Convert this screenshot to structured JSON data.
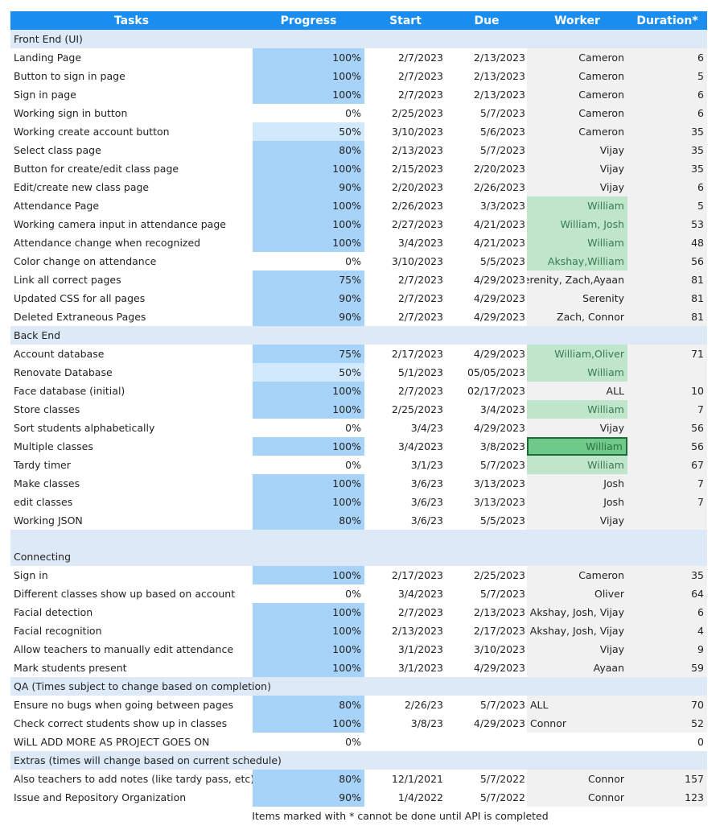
{
  "headers": {
    "task": "Tasks",
    "progress": "Progress",
    "start": "Start",
    "due": "Due",
    "worker": "Worker",
    "duration": "Duration*"
  },
  "colors": {
    "header": "#1a8ef0",
    "section": "#dde9f6",
    "progress_full": "#a8d3f8",
    "progress_mid": "#d2e8fc",
    "worker_bg": "#f1f1f1",
    "worker_green": "#bfe6cb",
    "worker_selected": "#6fca8a"
  },
  "sections": [
    {
      "title": "Front End (UI)",
      "rows": [
        {
          "task": "Landing Page",
          "progress": "100%",
          "start": "2/7/2023",
          "due": "2/13/2023",
          "worker": "Cameron",
          "duration": "6"
        },
        {
          "task": "Button to sign in page",
          "progress": "100%",
          "start": "2/7/2023",
          "due": "2/13/2023",
          "worker": "Cameron",
          "duration": "5"
        },
        {
          "task": "Sign in page",
          "progress": "100%",
          "start": "2/7/2023",
          "due": "2/13/2023",
          "worker": "Cameron",
          "duration": "6"
        },
        {
          "task": "Working sign in button",
          "progress": "0%",
          "start": "2/25/2023",
          "due": "5/7/2023",
          "worker": "Cameron",
          "duration": "6"
        },
        {
          "task": "Working create account button",
          "progress": "50%",
          "start": "3/10/2023",
          "due": "5/6/2023",
          "worker": "Cameron",
          "duration": "35"
        },
        {
          "task": "Select class page",
          "progress": "80%",
          "start": "2/13/2023",
          "due": "5/7/2023",
          "worker": "Vijay",
          "duration": "35"
        },
        {
          "task": "Button for create/edit class page",
          "progress": "100%",
          "start": "2/15/2023",
          "due": "2/20/2023",
          "worker": "Vijay",
          "duration": "35"
        },
        {
          "task": "Edit/create new class page",
          "progress": "90%",
          "start": "2/20/2023",
          "due": "2/26/2023",
          "worker": "Vijay",
          "duration": "6"
        },
        {
          "task": "Attendance Page",
          "progress": "100%",
          "start": "2/26/2023",
          "due": "3/3/2023",
          "worker": "William",
          "duration": "5",
          "style": "green"
        },
        {
          "task": "Working camera input in attendance page",
          "progress": "100%",
          "start": "2/27/2023",
          "due": "4/21/2023",
          "worker": "William, Josh",
          "duration": "53",
          "style": "green"
        },
        {
          "task": "Attendance change when recognized",
          "progress": "100%",
          "start": "3/4/2023",
          "due": "4/21/2023",
          "worker": "William",
          "duration": "48",
          "style": "green"
        },
        {
          "task": "Color change on attendance",
          "progress": "0%",
          "start": "3/10/2023",
          "due": "5/5/2023",
          "worker": "Akshay,William",
          "duration": "56",
          "style": "green"
        },
        {
          "task": "Link all correct pages",
          "progress": "75%",
          "start": "2/7/2023",
          "due": "4/29/2023",
          "worker": "Serenity, Zach,Ayaan",
          "duration": "81"
        },
        {
          "task": "Updated CSS for all pages",
          "progress": "90%",
          "start": "2/7/2023",
          "due": "4/29/2023",
          "worker": "Serenity",
          "duration": "81"
        },
        {
          "task": "Deleted Extraneous Pages",
          "progress": "90%",
          "start": "2/7/2023",
          "due": "4/29/2023",
          "worker": "Zach, Connor",
          "duration": "81"
        }
      ]
    },
    {
      "title": "Back End",
      "rows": [
        {
          "task": "Account database",
          "progress": "75%",
          "start": "2/17/2023",
          "due": "4/29/2023",
          "worker": "William,Oliver",
          "duration": "71",
          "style": "green"
        },
        {
          "task": "Renovate Database",
          "progress": "50%",
          "start": "5/1/2023",
          "due": "05/05/2023",
          "worker": "William",
          "duration": "",
          "style": "green"
        },
        {
          "task": "Face database (initial)",
          "progress": "100%",
          "start": "2/7/2023",
          "due": "02/17/2023",
          "worker": "ALL",
          "duration": "10"
        },
        {
          "task": "Store classes",
          "progress": "100%",
          "start": "2/25/2023",
          "due": "3/4/2023",
          "worker": "William",
          "duration": "7",
          "style": "green"
        },
        {
          "task": "Sort students alphabetically",
          "progress": "0%",
          "start": "3/4/23",
          "due": "4/29/2023",
          "worker": "Vijay",
          "duration": "56"
        },
        {
          "task": "Multiple classes",
          "progress": "100%",
          "start": "3/4/2023",
          "due": "3/8/2023",
          "worker": "William",
          "duration": "56",
          "style": "selected"
        },
        {
          "task": "Tardy timer",
          "progress": "0%",
          "start": "3/1/23",
          "due": "5/7/2023",
          "worker": "William",
          "duration": "67",
          "style": "green"
        },
        {
          "task": "Make classes",
          "progress": "100%",
          "start": "3/6/23",
          "due": "3/13/2023",
          "worker": "Josh",
          "duration": "7"
        },
        {
          "task": "edit classes",
          "progress": "100%",
          "start": "3/6/23",
          "due": "3/13/2023",
          "worker": "Josh",
          "duration": "7"
        },
        {
          "task": "Working JSON",
          "progress": "80%",
          "start": "3/6/23",
          "due": "5/5/2023",
          "worker": "Vijay",
          "duration": ""
        }
      ]
    },
    {
      "title": "Connecting",
      "tall": true,
      "rows": [
        {
          "task": "Sign in",
          "progress": "100%",
          "start": "2/17/2023",
          "due": "2/25/2023",
          "worker": "Cameron",
          "duration": "35"
        },
        {
          "task": "Different classes show up based on account",
          "progress": "0%",
          "start": "3/4/2023",
          "due": "5/7/2023",
          "worker": "Oliver",
          "duration": "64"
        },
        {
          "task": "Facial detection",
          "progress": "100%",
          "start": "2/7/2023",
          "due": "2/13/2023",
          "worker": "Akshay, Josh, Vijay",
          "duration": "6"
        },
        {
          "task": "Facial recognition",
          "progress": "100%",
          "start": "2/13/2023",
          "due": "2/17/2023",
          "worker": "Akshay, Josh, Vijay",
          "duration": "4"
        },
        {
          "task": "Allow teachers to manually edit attendance",
          "progress": "100%",
          "start": "3/1/2023",
          "due": "3/10/2023",
          "worker": "Vijay",
          "duration": "9"
        },
        {
          "task": "Mark students present",
          "progress": "100%",
          "start": "3/1/2023",
          "due": "4/29/2023",
          "worker": "Ayaan",
          "duration": "59"
        }
      ]
    },
    {
      "title": "QA (Times subject to change based on completion)",
      "rows": [
        {
          "task": "Ensure no bugs when going between pages",
          "progress": "80%",
          "start": "2/26/23",
          "due": "5/7/2023",
          "worker": "ALL",
          "duration": "70",
          "style": "left"
        },
        {
          "task": "Check correct students show up in classes",
          "progress": "100%",
          "start": "3/8/23",
          "due": "4/29/2023",
          "worker": "Connor",
          "duration": "52",
          "style": "left"
        },
        {
          "task": "WiLL ADD MORE AS PROJECT GOES ON",
          "progress": "0%",
          "start": "",
          "due": "",
          "worker": "",
          "duration": "0",
          "style": "blank"
        }
      ]
    },
    {
      "title": "Extras (times will change based on current schedule)",
      "rows": [
        {
          "task": "Also teachers to add notes (like tardy pass, etc)",
          "progress": "80%",
          "start": "12/1/2021",
          "due": "5/7/2022",
          "worker": "Connor",
          "duration": "157"
        },
        {
          "task": "Issue and Repository Organization",
          "progress": "90%",
          "start": "1/4/2022",
          "due": "5/7/2022",
          "worker": "Connor",
          "duration": "123"
        }
      ]
    }
  ],
  "footnote": "Items marked with * cannot be done until API is completed"
}
